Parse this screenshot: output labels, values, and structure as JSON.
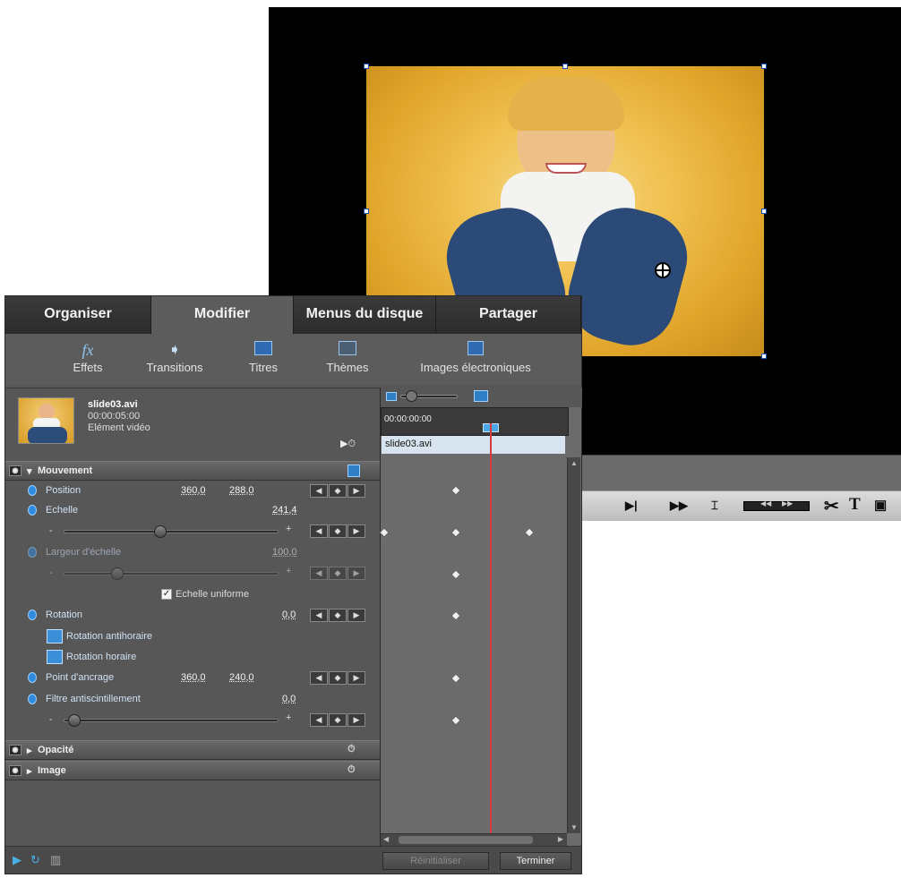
{
  "tabs": [
    "Organiser",
    "Modifier",
    "Menus du disque",
    "Partager"
  ],
  "tools": {
    "effets": "Effets",
    "transitions": "Transitions",
    "titres": "Titres",
    "themes": "Thèmes",
    "images": "Images électroniques"
  },
  "clip": {
    "name": "slide03.avi",
    "duration": "00:00:05:00",
    "type": "Elément vidéo"
  },
  "sections": {
    "mouvement": "Mouvement",
    "opacite": "Opacité",
    "image": "Image"
  },
  "properties": {
    "position_label": "Position",
    "position_x": "360,0",
    "position_y": "288,0",
    "echelle_label": "Echelle",
    "echelle_value": "241,4",
    "largeur_label": "Largeur d'échelle",
    "largeur_value": "100,0",
    "uniform_label": "Echelle uniforme",
    "rotation_label": "Rotation",
    "rotation_value": "0,0",
    "rot_anti_label": "Rotation antihoraire",
    "rot_hor_label": "Rotation horaire",
    "ancrage_label": "Point d'ancrage",
    "ancrage_x": "360,0",
    "ancrage_y": "240,0",
    "filtre_label": "Filtre antiscintillement",
    "filtre_value": "0,0"
  },
  "slider_levels": {
    "echelle": 0.45,
    "largeur": 0.25,
    "filtre": 0.05
  },
  "timeline": {
    "timecode": "00:00:00:00",
    "clip_label": "slide03.avi"
  },
  "buttons": {
    "reset": "Réinitialiser",
    "done": "Terminer"
  },
  "colors": {
    "playhead": "#d9393a",
    "accent": "#2f8be0"
  }
}
